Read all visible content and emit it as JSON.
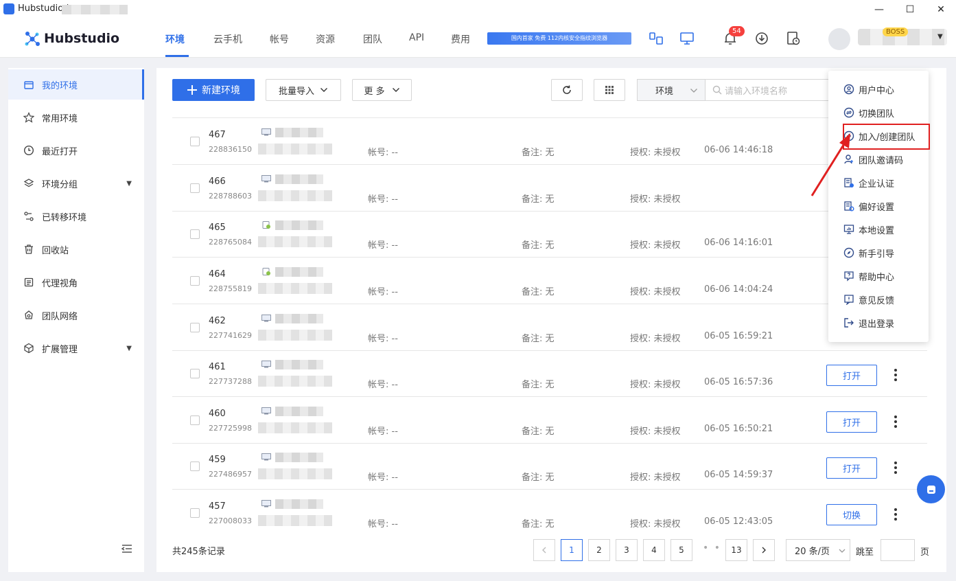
{
  "window": {
    "title": "Hubstudio |",
    "minimize": "—",
    "maximize": "☐",
    "close": "✕"
  },
  "header": {
    "brand": "Hubstudio",
    "tabs": [
      {
        "label": "环境",
        "active": true
      },
      {
        "label": "云手机"
      },
      {
        "label": "帐号"
      },
      {
        "label": "资源"
      },
      {
        "label": "团队"
      },
      {
        "label": "API"
      },
      {
        "label": "费用"
      }
    ],
    "banner_text": "国内首家 免费 112内核安全指纹浏览器",
    "notification_count": "54",
    "user_tag": "BOSS"
  },
  "sidebar": {
    "items": [
      {
        "label": "我的环境",
        "icon": "store-icon",
        "active": true
      },
      {
        "label": "常用环境",
        "icon": "star-icon"
      },
      {
        "label": "最近打开",
        "icon": "clock-icon"
      },
      {
        "label": "环境分组",
        "icon": "layers-icon",
        "expandable": true
      },
      {
        "label": "已转移环境",
        "icon": "transfer-icon"
      },
      {
        "label": "回收站",
        "icon": "trash-icon"
      },
      {
        "label": "代理视角",
        "icon": "proxy-icon"
      },
      {
        "label": "团队网络",
        "icon": "network-icon"
      },
      {
        "label": "扩展管理",
        "icon": "extension-icon",
        "expandable": true
      }
    ]
  },
  "toolbar": {
    "new_env": "新建环境",
    "batch_import": "批量导入",
    "more": "更 多",
    "env_select": "环境",
    "search_placeholder": "请输入环境名称"
  },
  "rows": [
    {
      "num": "467",
      "id": "228836150",
      "os": "windows",
      "account": "帐号: --",
      "note": "备注: 无",
      "auth": "授权: 未授权",
      "time": "06-06 14:46:18",
      "action": ""
    },
    {
      "num": "466",
      "id": "228788603",
      "os": "windows",
      "account": "帐号: --",
      "note": "备注: 无",
      "auth": "授权: 未授权",
      "time": "",
      "action": ""
    },
    {
      "num": "465",
      "id": "228765084",
      "os": "android",
      "account": "帐号: --",
      "note": "备注: 无",
      "auth": "授权: 未授权",
      "time": "06-06 14:16:01",
      "action": ""
    },
    {
      "num": "464",
      "id": "228755819",
      "os": "android",
      "account": "帐号: --",
      "note": "备注: 无",
      "auth": "授权: 未授权",
      "time": "06-06 14:04:24",
      "action": ""
    },
    {
      "num": "462",
      "id": "227741629",
      "os": "windows",
      "account": "帐号: --",
      "note": "备注: 无",
      "auth": "授权: 未授权",
      "time": "06-05 16:59:21",
      "action": ""
    },
    {
      "num": "461",
      "id": "227737288",
      "os": "windows",
      "account": "帐号: --",
      "note": "备注: 无",
      "auth": "授权: 未授权",
      "time": "06-05 16:57:36",
      "action": "打开"
    },
    {
      "num": "460",
      "id": "227725998",
      "os": "windows",
      "account": "帐号: --",
      "note": "备注: 无",
      "auth": "授权: 未授权",
      "time": "06-05 16:50:21",
      "action": "打开"
    },
    {
      "num": "459",
      "id": "227486957",
      "os": "windows",
      "account": "帐号: --",
      "note": "备注: 无",
      "auth": "授权: 未授权",
      "time": "06-05 14:59:37",
      "action": "打开"
    },
    {
      "num": "457",
      "id": "227008033",
      "os": "windows",
      "account": "帐号: --",
      "note": "备注: 无",
      "auth": "授权: 未授权",
      "time": "06-05 12:43:05",
      "action": "切换"
    }
  ],
  "footer": {
    "total": "共245条记录",
    "pages": [
      "1",
      "2",
      "3",
      "4",
      "5"
    ],
    "ellipsis": "• • •",
    "last_page": "13",
    "current_page": "1",
    "page_size": "20 条/页",
    "jump_label": "跳至",
    "page_label": "页"
  },
  "user_menu": {
    "items": [
      {
        "label": "用户中心",
        "icon": "user-circle-icon"
      },
      {
        "label": "切换团队",
        "icon": "switch-team-icon"
      },
      {
        "label": "加入/创建团队",
        "icon": "plus-circle-icon",
        "highlighted": true
      },
      {
        "label": "团队邀请码",
        "icon": "invite-icon"
      },
      {
        "label": "企业认证",
        "icon": "enterprise-icon"
      },
      {
        "label": "偏好设置",
        "icon": "preference-icon"
      },
      {
        "label": "本地设置",
        "icon": "monitor-icon"
      },
      {
        "label": "新手引导",
        "icon": "compass-icon"
      },
      {
        "label": "帮助中心",
        "icon": "help-icon"
      },
      {
        "label": "意见反馈",
        "icon": "feedback-icon"
      },
      {
        "label": "退出登录",
        "icon": "logout-icon"
      }
    ]
  },
  "colors": {
    "primary": "#2f6fe8",
    "highlight": "#e02020",
    "badge": "#f5403d"
  }
}
